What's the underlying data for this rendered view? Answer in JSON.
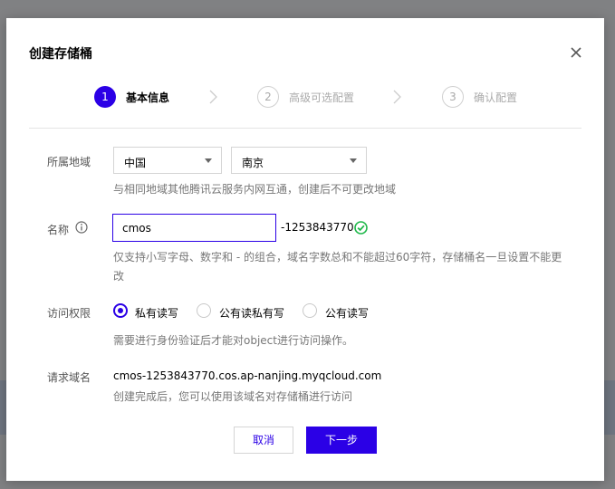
{
  "dialog": {
    "title": "创建存储桶",
    "close_icon": "close-icon"
  },
  "steps": [
    {
      "number": "1",
      "label": "基本信息",
      "state": "active"
    },
    {
      "number": "2",
      "label": "高级可选配置",
      "state": "inactive"
    },
    {
      "number": "3",
      "label": "确认配置",
      "state": "inactive"
    }
  ],
  "region": {
    "label": "所属地域",
    "country": "中国",
    "city": "南京",
    "hint": "与相同地域其他腾讯云服务内网互通，创建后不可更改地域"
  },
  "name": {
    "label": "名称",
    "value": "cmos",
    "suffix": "-1253843770",
    "hint_line1": "仅支持小写字母、数字和 - 的组合，域名字数总和不能超过60字符，存储桶名一旦设置不能更",
    "hint_line2": "改"
  },
  "access": {
    "label": "访问权限",
    "options": [
      "私有读写",
      "公有读私有写",
      "公有读写"
    ],
    "selected": "私有读写",
    "hint": "需要进行身份验证后才能对object进行访问操作。"
  },
  "domain": {
    "label": "请求域名",
    "value": "cmos-1253843770.cos.ap-nanjing.myqcloud.com",
    "hint": "创建完成后，您可以使用该域名对存储桶进行访问"
  },
  "buttons": {
    "cancel": "取消",
    "next": "下一步"
  },
  "colors": {
    "accent": "#2b00e6",
    "success": "#1fb84a"
  }
}
